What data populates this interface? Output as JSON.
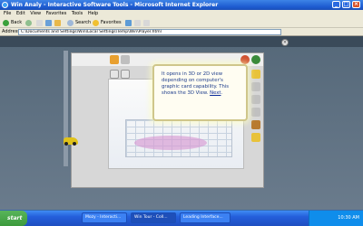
{
  "window": {
    "title": "Win Analy - Interactive Software Tools - Microsoft Internet Explorer",
    "min": "_",
    "max": "□",
    "close": "×"
  },
  "menu": [
    "File",
    "Edit",
    "View",
    "Favorites",
    "Tools",
    "Help"
  ],
  "toolbar": {
    "back_label": "Back",
    "search_label": "Search",
    "favorites_label": "Favorites"
  },
  "address": {
    "label": "Address",
    "value": "C:\\Documents and Settings\\Win\\Local Settings\\Temp\\Win\\Player.html"
  },
  "content": {
    "close_glyph": "×",
    "tooltip": {
      "text": "It opens in 3D or 2D view depending on computer's graphic card capability. This shows the 3D View.",
      "link": "Next"
    }
  },
  "taskbar": {
    "start": "start",
    "items": [
      "Mozy - Interacti...",
      "Win Tour - Coll...",
      "Leading Interface..."
    ],
    "clock": "10:30 AM"
  },
  "colors": {
    "titlebar": "#1d5bd0",
    "tooltip_border": "#cfc68a",
    "ellipse": "#d79ad2",
    "car": "#e0c21a"
  }
}
